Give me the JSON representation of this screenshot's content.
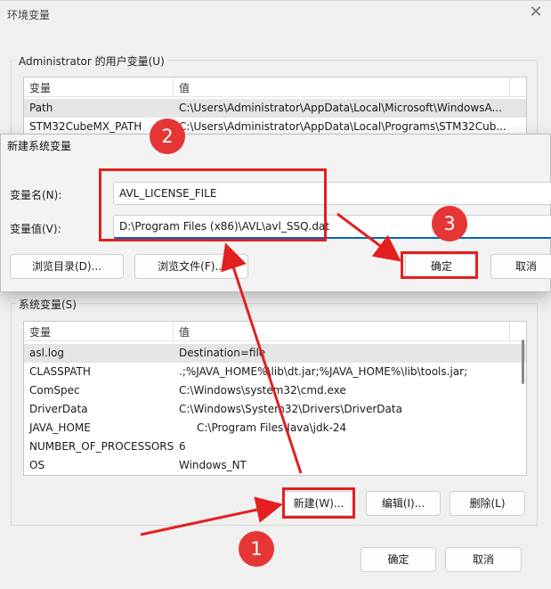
{
  "window": {
    "title": "环境变量",
    "close_glyph": "✕"
  },
  "user_vars": {
    "group_label": "Administrator 的用户变量(U)",
    "columns": [
      "变量",
      "值"
    ],
    "rows": [
      {
        "name": "Path",
        "value": "C:\\Users\\Administrator\\AppData\\Local\\Microsoft\\WindowsA..."
      },
      {
        "name": "STM32CubeMX_PATH",
        "value": "C:\\Users\\Administrator\\AppData\\Local\\Programs\\STM32Cub..."
      }
    ]
  },
  "dialog": {
    "title": "新建系统变量",
    "name_label": "变量名(N):",
    "name_value": "AVL_LICENSE_FILE",
    "value_label": "变量值(V):",
    "value_value": "D:\\Program Files (x86)\\AVL\\avl_SSQ.dat",
    "browse_dir": "浏览目录(D)...",
    "browse_file": "浏览文件(F)...",
    "ok": "确定",
    "cancel": "取消"
  },
  "sys_vars": {
    "group_label": "系统变量(S)",
    "columns": [
      "变量",
      "值"
    ],
    "rows": [
      {
        "name": "asl.log",
        "value": "Destination=file"
      },
      {
        "name": "CLASSPATH",
        "value": ".;%JAVA_HOME%\\lib\\dt.jar;%JAVA_HOME%\\lib\\tools.jar;"
      },
      {
        "name": "ComSpec",
        "value": "C:\\Windows\\system32\\cmd.exe"
      },
      {
        "name": "DriverData",
        "value": "C:\\Windows\\System32\\Drivers\\DriverData"
      },
      {
        "name": "JAVA_HOME",
        "value": "C:\\Program Files\\Java\\jdk-24"
      },
      {
        "name": "NUMBER_OF_PROCESSORS",
        "value": "6"
      },
      {
        "name": "OS",
        "value": "Windows_NT"
      }
    ],
    "new_button": "新建(W)...",
    "edit_button": "编辑(I)...",
    "delete_button": "删除(L)"
  },
  "footer": {
    "ok": "确定",
    "cancel": "取消"
  },
  "annotations": {
    "step1": "1",
    "step2": "2",
    "step3": "3",
    "color": "#e22020"
  }
}
